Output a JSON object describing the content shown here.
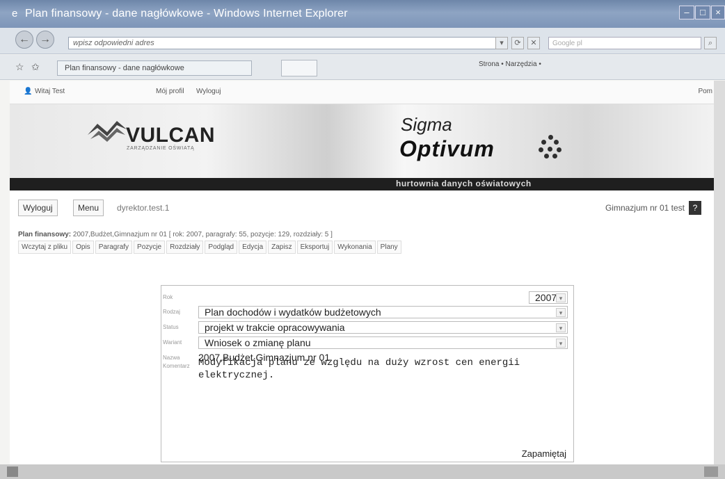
{
  "window": {
    "title": "Plan finansowy - dane nagłówkowe - Windows Internet Explorer"
  },
  "browser": {
    "address_placeholder": "wpisz odpowiedni adres",
    "search_placeholder": "Google pl",
    "tab_label": "Plan finansowy - dane nagłówkowe",
    "tools": "Strona • Narzędzia •"
  },
  "topmenu": {
    "welcome": "Witaj Test",
    "profile": "Mój profil",
    "logout": "Wyloguj",
    "help": "Pom"
  },
  "banner": {
    "vulcan": "VULCAN",
    "vulcan_sub": "ZARZĄDZANIE OŚWIATĄ",
    "sigma": "Sigma",
    "optivum": "Optivum",
    "tagline": "hurtownia danych oświatowych"
  },
  "toolbar": {
    "logout": "Wyloguj",
    "menu": "Menu",
    "user": "dyrektor.test.1",
    "school": "Gimnazjum nr 01 test",
    "help": "?"
  },
  "info": {
    "label": "Plan finansowy:",
    "value": "2007,Budżet,Gimnazjum nr 01 [ rok: 2007, paragrafy: 55, pozycje: 129, rozdziały: 5 ]"
  },
  "tabs": [
    "Wczytaj z pliku",
    "Opis",
    "Paragrafy",
    "Pozycje",
    "Rozdziały",
    "Podgląd",
    "Edycja",
    "Zapisz",
    "Eksportuj",
    "Wykonania",
    "Plany"
  ],
  "form": {
    "rok_label": "Rok",
    "rok_value": "2007",
    "rodzaj_label": "Rodzaj",
    "rodzaj_value": "Plan dochodów i wydatków budżetowych",
    "status_label": "Status",
    "status_value": "projekt w trakcie opracowywania",
    "wariant_label": "Wariant",
    "wariant_value": "Wniosek o zmianę planu",
    "nazwa_label": "Nazwa",
    "nazwa_value": "2007,Budżet,Gimnazjum nr 01",
    "komentarz_label": "Komentarz",
    "komentarz_value": "Modyfikacja planu ze względu na duży wzrost cen energii\nelektrycznej.",
    "save": "Zapamiętaj"
  }
}
